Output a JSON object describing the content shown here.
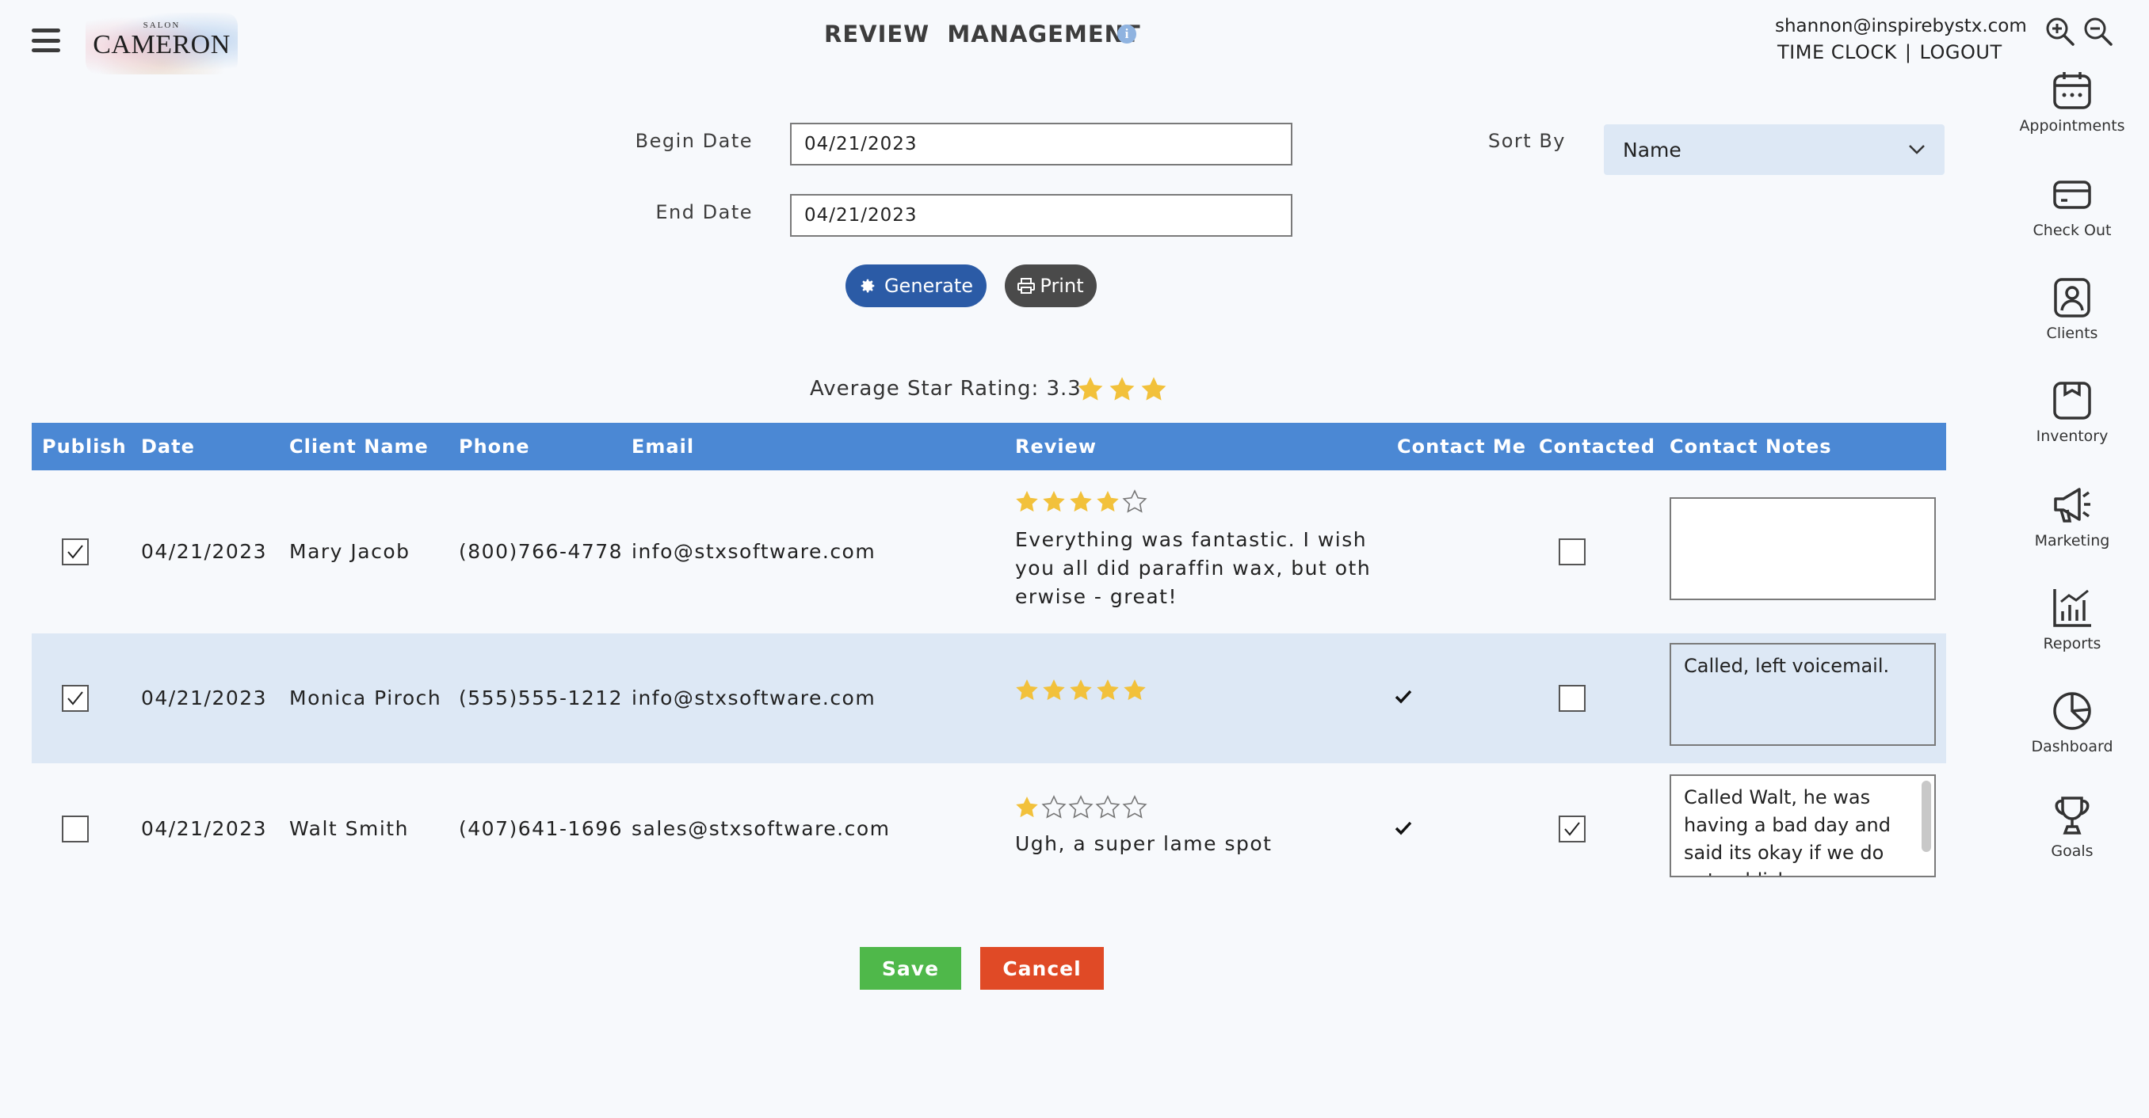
{
  "header": {
    "logo_small": "SALON",
    "logo_main": "CAMERON",
    "title": "REVIEW  MANAGEMENT",
    "info_glyph": "i",
    "user_email": "shannon@inspirebystx.com",
    "time_clock": "TIME CLOCK",
    "separator": "|",
    "logout": "LOGOUT"
  },
  "form": {
    "begin_date_label": "Begin Date",
    "begin_date_value": "04/21/2023",
    "end_date_label": "End Date",
    "end_date_value": "04/21/2023",
    "sort_by_label": "Sort By",
    "sort_by_value": "Name",
    "generate_label": "Generate",
    "print_label": "Print"
  },
  "summary": {
    "average_label": "Average Star Rating: 3.3",
    "average_stars": 3
  },
  "table": {
    "columns": [
      "Publish",
      "Date",
      "Client Name",
      "Phone",
      "Email",
      "Review",
      "Contact Me",
      "Contacted",
      "Contact Notes"
    ],
    "rows": [
      {
        "publish": true,
        "date": "04/21/2023",
        "client": "Mary Jacob",
        "phone": "(800)766-4778",
        "email": "info@stxsoftware.com",
        "stars": 4,
        "review": "Everything was fantastic. I wish you all did paraffin wax, but otherwise - great!",
        "contact_me": false,
        "contacted": false,
        "notes": ""
      },
      {
        "publish": true,
        "date": "04/21/2023",
        "client": "Monica Piroch",
        "phone": "(555)555-1212",
        "email": "info@stxsoftware.com",
        "stars": 5,
        "review": "",
        "contact_me": true,
        "contacted": false,
        "notes": "Called, left voicemail."
      },
      {
        "publish": false,
        "date": "04/21/2023",
        "client": "Walt Smith",
        "phone": "(407)641-1696",
        "email": "sales@stxsoftware.com",
        "stars": 1,
        "review": "Ugh, a super lame spot",
        "contact_me": true,
        "contacted": true,
        "notes": "Called Walt, he was having a bad day and said its okay if we do not publish"
      }
    ]
  },
  "actions": {
    "save_label": "Save",
    "cancel_label": "Cancel"
  },
  "sidebar": {
    "items": [
      {
        "label": "Appointments",
        "icon": "calendar-icon"
      },
      {
        "label": "Check Out",
        "icon": "credit-card-icon"
      },
      {
        "label": "Clients",
        "icon": "client-icon"
      },
      {
        "label": "Inventory",
        "icon": "inventory-icon"
      },
      {
        "label": "Marketing",
        "icon": "megaphone-icon"
      },
      {
        "label": "Reports",
        "icon": "reports-icon"
      },
      {
        "label": "Dashboard",
        "icon": "pie-chart-icon"
      },
      {
        "label": "Goals",
        "icon": "trophy-icon"
      }
    ]
  },
  "colors": {
    "header_blue": "#4b88d4",
    "row_alt": "#dde8f5",
    "generate": "#2b5ba6",
    "print": "#4a4a4a",
    "save": "#4fb84a",
    "cancel": "#e04a26",
    "star": "#f2c13b"
  }
}
